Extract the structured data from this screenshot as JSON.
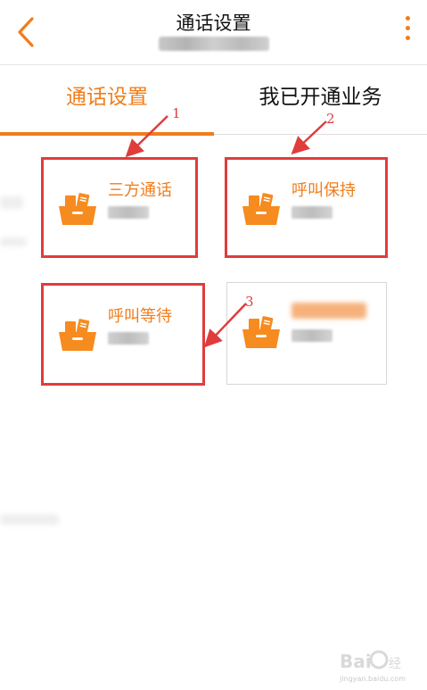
{
  "header": {
    "title": "通话设置",
    "back_icon": "chevron-left-icon",
    "more_icon": "more-vertical-icon"
  },
  "tabs": [
    {
      "label": "通话设置",
      "active": true
    },
    {
      "label": "我已开通业务",
      "active": false
    }
  ],
  "cards": [
    {
      "name": "三方通话",
      "highlighted": true,
      "icon": "shopping-basket-icon"
    },
    {
      "name": "呼叫保持",
      "highlighted": true,
      "icon": "shopping-basket-icon"
    },
    {
      "name": "呼叫等待",
      "highlighted": true,
      "icon": "shopping-basket-icon"
    },
    {
      "name": "",
      "highlighted": false,
      "icon": "shopping-basket-icon"
    }
  ],
  "annotations": [
    "1",
    "2",
    "3"
  ],
  "watermark": {
    "text": "jingyan.baidu.com"
  },
  "colors": {
    "accent": "#f07d1b",
    "annotation": "#e03c3c",
    "icon": "#f68b1f"
  }
}
